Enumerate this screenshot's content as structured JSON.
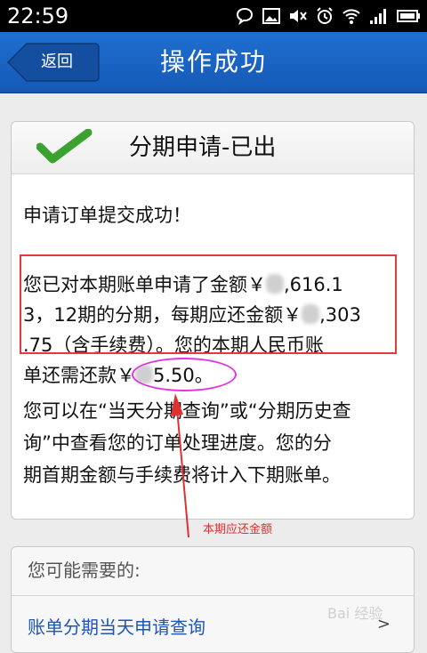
{
  "status_bar": {
    "time": "22:59"
  },
  "nav": {
    "back_label": "返回",
    "title": "操作成功"
  },
  "card": {
    "title": "分期申请-已出",
    "success_line": "申请订单提交成功！",
    "detail": {
      "l1a": "您已对本期账单申请了金额￥",
      "l1b": ",616.1",
      "l2a": "3，12期的分期，每期应还金额￥",
      "l2b": ",303",
      "l3": ".75（含手续费）。您的本期人民币账",
      "l4a": "单还需还款￥",
      "l4b": "5.50。"
    },
    "hint": {
      "l1": "您可以在“当天分期查询”或“分期历史查",
      "l2": "询”中查看您的订单处理进度。您的分",
      "l3": "期首期金额与手续费将计入下期账单。"
    }
  },
  "annotation": {
    "label": "本期应还金额",
    "color": "#e03030"
  },
  "suggest": {
    "title": "您可能需要的:",
    "link": "账单分期当天申请查询",
    "chevron": ">"
  },
  "watermark": "Bai 经验",
  "colors": {
    "nav_blue": "#1f6fd0",
    "check_green": "#3aa330",
    "highlight_red": "#e43a3a",
    "highlight_magenta": "#e235e2"
  }
}
